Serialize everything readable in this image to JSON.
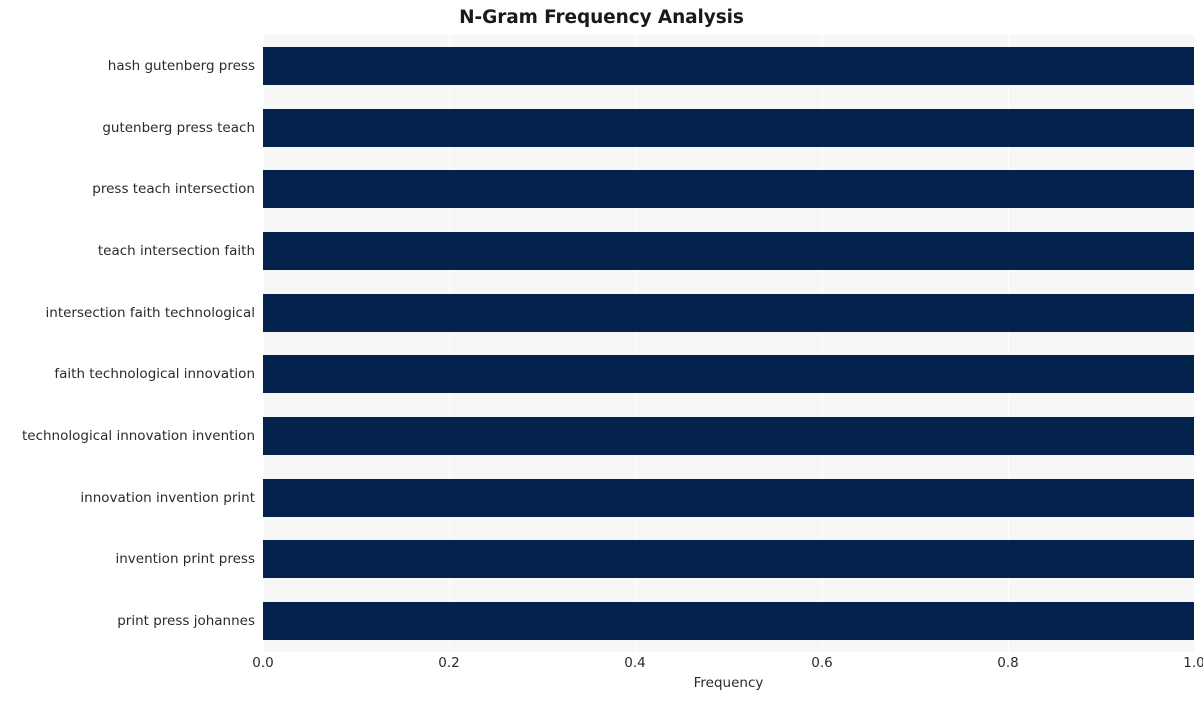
{
  "chart_data": {
    "type": "bar",
    "orientation": "horizontal",
    "title": "N-Gram Frequency Analysis",
    "xlabel": "Frequency",
    "ylabel": "",
    "xlim": [
      0.0,
      1.0
    ],
    "xticks": [
      0.0,
      0.2,
      0.4,
      0.6,
      0.8,
      1.0
    ],
    "xtick_labels": [
      "0.0",
      "0.2",
      "0.4",
      "0.6",
      "0.8",
      "1.0"
    ],
    "grid": "vertical",
    "legend": "none",
    "bar_color": "#03224c",
    "plot_background": "#f7f7f7",
    "categories": [
      "hash gutenberg press",
      "gutenberg press teach",
      "press teach intersection",
      "teach intersection faith",
      "intersection faith technological",
      "faith technological innovation",
      "technological innovation invention",
      "innovation invention print",
      "invention print press",
      "print press johannes"
    ],
    "values": [
      1.0,
      1.0,
      1.0,
      1.0,
      1.0,
      1.0,
      1.0,
      1.0,
      1.0,
      1.0
    ]
  }
}
